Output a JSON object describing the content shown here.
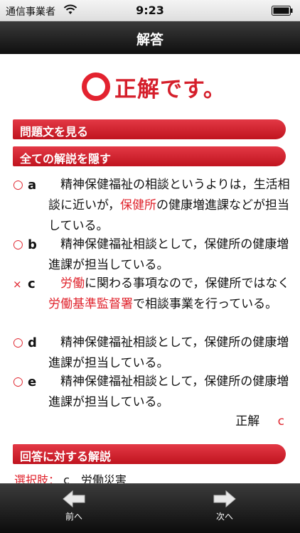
{
  "status_bar": {
    "carrier": "通信事業者",
    "time": "9:23"
  },
  "nav": {
    "title": "解答"
  },
  "result": {
    "text": "正解です。"
  },
  "sections": {
    "show_question": "問題文を見る",
    "hide_explanations": "全ての解説を隠す",
    "answer_explanation": "回答に対する解説"
  },
  "choices": [
    {
      "mark": "○",
      "letter": "a",
      "parts": [
        "精神保健福祉の相談というよりは，生活相談に近いが，",
        "保健所",
        "の健康増進課などが担当している。"
      ]
    },
    {
      "mark": "○",
      "letter": "b",
      "text": "精神保健福祉相談として，保健所の健康増進課が担当している。"
    },
    {
      "mark": "×",
      "letter": "c",
      "parts": [
        "労働",
        "に関わる事項なので，保健所ではなく",
        "労働基準監督署",
        "で相談事業を行っている。"
      ]
    },
    {
      "mark": "○",
      "letter": "d",
      "text": "精神保健福祉相談として，保健所の健康増進課が担当している。"
    },
    {
      "mark": "○",
      "letter": "e",
      "text": "精神保健福祉相談として，保健所の健康増進課が担当している。"
    }
  ],
  "answer": {
    "label": "正解",
    "value": "c"
  },
  "selection": {
    "label": "選択肢：",
    "value": "c　労働災害"
  },
  "toolbar": {
    "prev_label": "前へ",
    "next_label": "次へ"
  },
  "colors": {
    "accent_red": "#e0242d",
    "bar_red": "#c0141f"
  }
}
